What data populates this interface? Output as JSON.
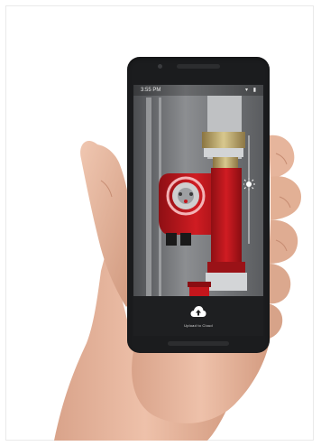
{
  "status_bar": {
    "time": "3:55 PM",
    "icons": "▾ ▮"
  },
  "capture": {
    "label": "Upload to Cloud",
    "icon": "cloud-upload-icon"
  },
  "colors": {
    "pump": "#c4161c",
    "phone": "#1b1c1e",
    "skin": "#e2b59c",
    "focus_ring": "#f3b3b6"
  }
}
